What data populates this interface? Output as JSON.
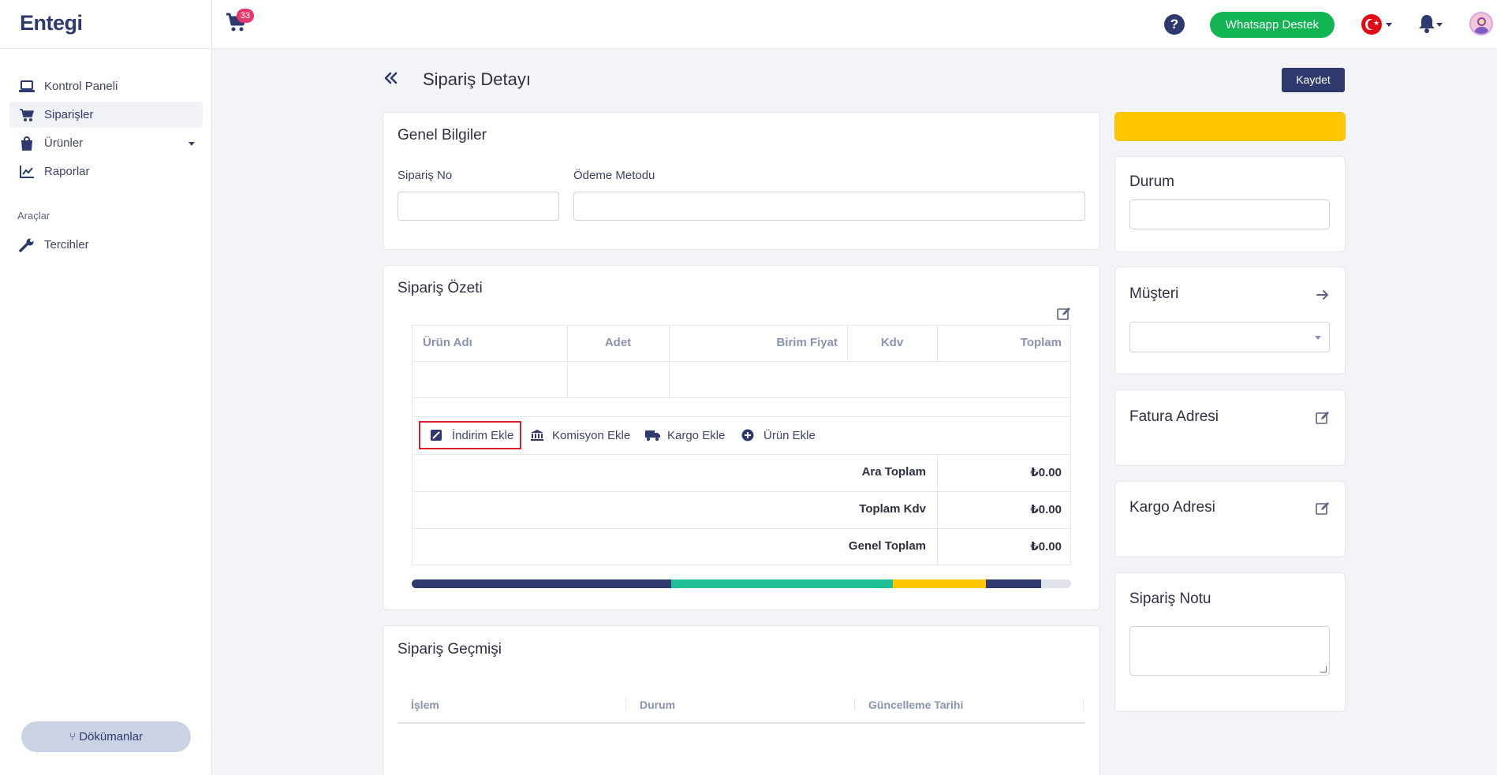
{
  "brand": "Entegi",
  "topbar": {
    "cart_count": "33",
    "help": "?",
    "whatsapp_label": "Whatsapp Destek"
  },
  "sidebar": {
    "items": [
      {
        "label": "Kontrol Paneli",
        "icon": "laptop-icon"
      },
      {
        "label": "Siparişler",
        "icon": "cart-icon"
      },
      {
        "label": "Ürünler",
        "icon": "bag-icon"
      },
      {
        "label": "Raporlar",
        "icon": "chart-line-icon"
      }
    ],
    "section": "Araçlar",
    "tools": [
      {
        "label": "Tercihler",
        "icon": "wrench-icon"
      }
    ],
    "docs_label": "Dökümanlar"
  },
  "page": {
    "title": "Sipariş Detayı",
    "save_label": "Kaydet"
  },
  "general": {
    "title": "Genel Bilgiler",
    "order_no_label": "Sipariş No",
    "order_no_value": "",
    "payment_label": "Ödeme Metodu",
    "payment_value": ""
  },
  "summary": {
    "title": "Sipariş Özeti",
    "columns": [
      "Ürün Adı",
      "Adet",
      "Birim Fiyat",
      "Kdv",
      "Toplam"
    ],
    "actions": [
      {
        "label": "İndirim Ekle",
        "icon": "discount-icon"
      },
      {
        "label": "Komisyon Ekle",
        "icon": "bank-icon"
      },
      {
        "label": "Kargo Ekle",
        "icon": "truck-icon"
      },
      {
        "label": "Ürün Ekle",
        "icon": "plus-circle-icon"
      }
    ],
    "totals": [
      {
        "label": "Ara Toplam",
        "value": "₺0.00"
      },
      {
        "label": "Toplam Kdv",
        "value": "₺0.00"
      },
      {
        "label": "Genel Toplam",
        "value": "₺0.00"
      }
    ],
    "progress_segments": [
      {
        "color": "#2e3a6e",
        "fraction": 0.393
      },
      {
        "color": "#21c197",
        "fraction": 0.337
      },
      {
        "color": "#ffc700",
        "fraction": 0.141
      },
      {
        "color": "#2e3a6e",
        "fraction": 0.084
      }
    ]
  },
  "history": {
    "title": "Sipariş Geçmişi",
    "columns": [
      "İşlem",
      "Durum",
      "Güncelleme Tarihi"
    ]
  },
  "right": {
    "status_title": "Durum",
    "status_value": "",
    "customer_title": "Müşteri",
    "customer_value": "",
    "invoice_title": "Fatura Adresi",
    "shipping_title": "Kargo Adresi",
    "note_title": "Sipariş Notu",
    "note_value": ""
  },
  "colors": {
    "primary": "#2e3a6e",
    "whatsapp": "#12b552",
    "warning": "#ffc700",
    "highlight": "#d81f26"
  }
}
